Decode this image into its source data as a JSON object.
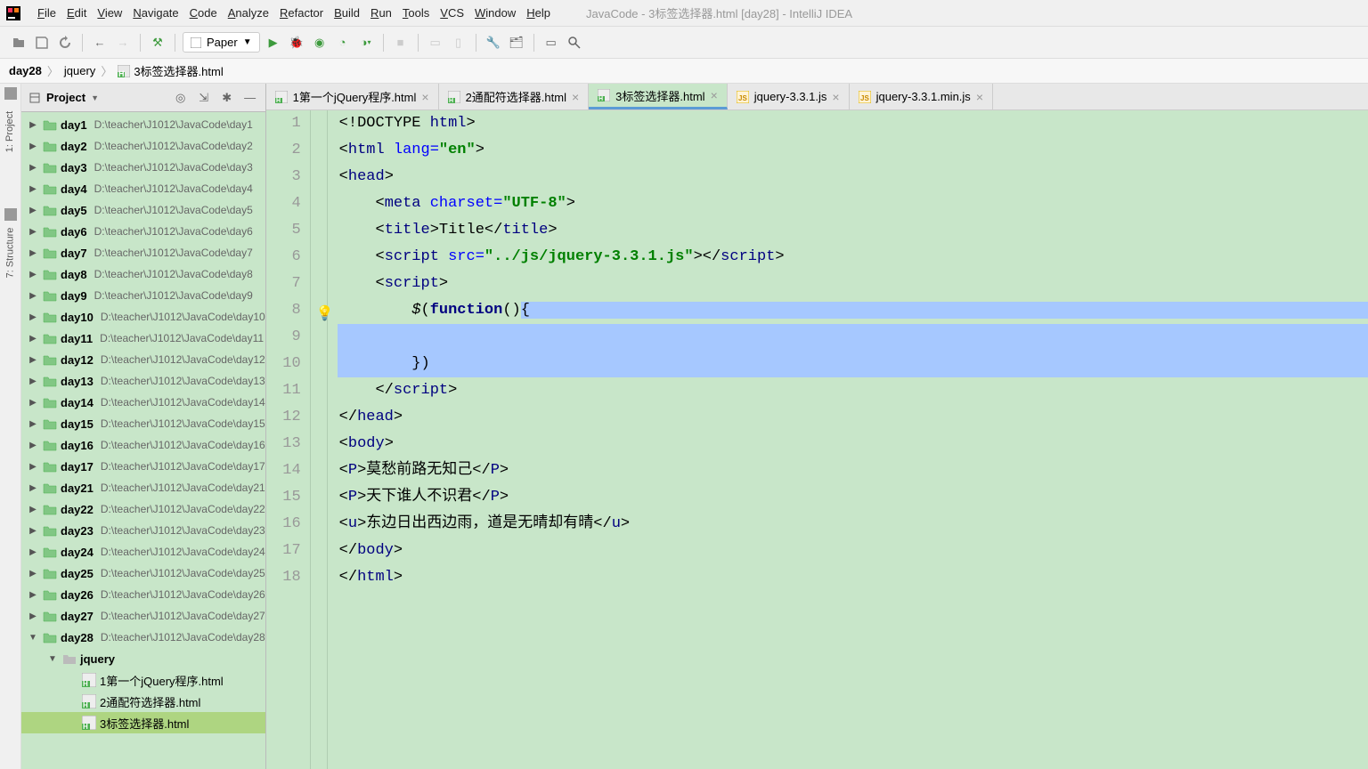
{
  "window_title": "JavaCode - 3标签选择器.html [day28] - IntelliJ IDEA",
  "menu": [
    "File",
    "Edit",
    "View",
    "Navigate",
    "Code",
    "Analyze",
    "Refactor",
    "Build",
    "Run",
    "Tools",
    "VCS",
    "Window",
    "Help"
  ],
  "config_selector": "Paper",
  "breadcrumb": [
    {
      "label": "day28",
      "icon": "folder"
    },
    {
      "label": "jquery",
      "icon": "none"
    },
    {
      "label": "3标签选择器.html",
      "icon": "html"
    }
  ],
  "left_rail": [
    {
      "label": "1: Project"
    },
    {
      "label": "7: Structure"
    }
  ],
  "project_panel_title": "Project",
  "tree": [
    {
      "name": "day1",
      "path": "D:\\teacher\\J1012\\JavaCode\\day1",
      "indent": 0,
      "expanded": false,
      "type": "folder"
    },
    {
      "name": "day2",
      "path": "D:\\teacher\\J1012\\JavaCode\\day2",
      "indent": 0,
      "expanded": false,
      "type": "folder"
    },
    {
      "name": "day3",
      "path": "D:\\teacher\\J1012\\JavaCode\\day3",
      "indent": 0,
      "expanded": false,
      "type": "folder"
    },
    {
      "name": "day4",
      "path": "D:\\teacher\\J1012\\JavaCode\\day4",
      "indent": 0,
      "expanded": false,
      "type": "folder"
    },
    {
      "name": "day5",
      "path": "D:\\teacher\\J1012\\JavaCode\\day5",
      "indent": 0,
      "expanded": false,
      "type": "folder"
    },
    {
      "name": "day6",
      "path": "D:\\teacher\\J1012\\JavaCode\\day6",
      "indent": 0,
      "expanded": false,
      "type": "folder"
    },
    {
      "name": "day7",
      "path": "D:\\teacher\\J1012\\JavaCode\\day7",
      "indent": 0,
      "expanded": false,
      "type": "folder"
    },
    {
      "name": "day8",
      "path": "D:\\teacher\\J1012\\JavaCode\\day8",
      "indent": 0,
      "expanded": false,
      "type": "folder"
    },
    {
      "name": "day9",
      "path": "D:\\teacher\\J1012\\JavaCode\\day9",
      "indent": 0,
      "expanded": false,
      "type": "folder"
    },
    {
      "name": "day10",
      "path": "D:\\teacher\\J1012\\JavaCode\\day10",
      "indent": 0,
      "expanded": false,
      "type": "folder"
    },
    {
      "name": "day11",
      "path": "D:\\teacher\\J1012\\JavaCode\\day11",
      "indent": 0,
      "expanded": false,
      "type": "folder"
    },
    {
      "name": "day12",
      "path": "D:\\teacher\\J1012\\JavaCode\\day12",
      "indent": 0,
      "expanded": false,
      "type": "folder"
    },
    {
      "name": "day13",
      "path": "D:\\teacher\\J1012\\JavaCode\\day13",
      "indent": 0,
      "expanded": false,
      "type": "folder"
    },
    {
      "name": "day14",
      "path": "D:\\teacher\\J1012\\JavaCode\\day14",
      "indent": 0,
      "expanded": false,
      "type": "folder"
    },
    {
      "name": "day15",
      "path": "D:\\teacher\\J1012\\JavaCode\\day15",
      "indent": 0,
      "expanded": false,
      "type": "folder"
    },
    {
      "name": "day16",
      "path": "D:\\teacher\\J1012\\JavaCode\\day16",
      "indent": 0,
      "expanded": false,
      "type": "folder"
    },
    {
      "name": "day17",
      "path": "D:\\teacher\\J1012\\JavaCode\\day17",
      "indent": 0,
      "expanded": false,
      "type": "folder"
    },
    {
      "name": "day21",
      "path": "D:\\teacher\\J1012\\JavaCode\\day21",
      "indent": 0,
      "expanded": false,
      "type": "folder"
    },
    {
      "name": "day22",
      "path": "D:\\teacher\\J1012\\JavaCode\\day22",
      "indent": 0,
      "expanded": false,
      "type": "folder"
    },
    {
      "name": "day23",
      "path": "D:\\teacher\\J1012\\JavaCode\\day23",
      "indent": 0,
      "expanded": false,
      "type": "folder"
    },
    {
      "name": "day24",
      "path": "D:\\teacher\\J1012\\JavaCode\\day24",
      "indent": 0,
      "expanded": false,
      "type": "folder"
    },
    {
      "name": "day25",
      "path": "D:\\teacher\\J1012\\JavaCode\\day25",
      "indent": 0,
      "expanded": false,
      "type": "folder"
    },
    {
      "name": "day26",
      "path": "D:\\teacher\\J1012\\JavaCode\\day26",
      "indent": 0,
      "expanded": false,
      "type": "folder"
    },
    {
      "name": "day27",
      "path": "D:\\teacher\\J1012\\JavaCode\\day27",
      "indent": 0,
      "expanded": false,
      "type": "folder"
    },
    {
      "name": "day28",
      "path": "D:\\teacher\\J1012\\JavaCode\\day28",
      "indent": 0,
      "expanded": true,
      "type": "folder"
    },
    {
      "name": "jquery",
      "path": "",
      "indent": 1,
      "expanded": true,
      "type": "folder-plain"
    },
    {
      "name": "1第一个jQuery程序.html",
      "path": "",
      "indent": 2,
      "type": "html"
    },
    {
      "name": "2通配符选择器.html",
      "path": "",
      "indent": 2,
      "type": "html"
    },
    {
      "name": "3标签选择器.html",
      "path": "",
      "indent": 2,
      "type": "html",
      "selected": true
    }
  ],
  "tabs": [
    {
      "label": "1第一个jQuery程序.html",
      "icon": "html",
      "active": false
    },
    {
      "label": "2通配符选择器.html",
      "icon": "html",
      "active": false
    },
    {
      "label": "3标签选择器.html",
      "icon": "html",
      "active": true
    },
    {
      "label": "jquery-3.3.1.js",
      "icon": "js",
      "active": false
    },
    {
      "label": "jquery-3.3.1.min.js",
      "icon": "js",
      "active": false
    }
  ],
  "code_lines": [
    {
      "n": 1,
      "html": "&lt;!DOCTYPE <span class='tag'>html</span>&gt;"
    },
    {
      "n": 2,
      "html": "&lt;<span class='tag'>html </span><span class='attr'>lang=</span><span class='str'>\"en\"</span>&gt;"
    },
    {
      "n": 3,
      "html": "&lt;<span class='tag'>head</span>&gt;"
    },
    {
      "n": 4,
      "html": "    &lt;<span class='tag'>meta </span><span class='attr'>charset=</span><span class='str'>\"UTF-8\"</span>&gt;"
    },
    {
      "n": 5,
      "html": "    &lt;<span class='tag'>title</span>&gt;Title&lt;/<span class='tag'>title</span>&gt;"
    },
    {
      "n": 6,
      "html": "    &lt;<span class='tag'>script </span><span class='attr'>src=</span><span class='str'>\"../js/jquery-3.3.1.js\"</span>&gt;&lt;/<span class='tag'>script</span>&gt;"
    },
    {
      "n": 7,
      "html": "    &lt;<span class='tag'>script</span>&gt;"
    },
    {
      "n": 8,
      "html": "        <span class='dollar'>$</span>(<span class='kw'>function</span>(){",
      "sel": "after",
      "bulb": true
    },
    {
      "n": 9,
      "html": "",
      "sel": "full"
    },
    {
      "n": 10,
      "html": "        })",
      "sel": "full"
    },
    {
      "n": 11,
      "html": "    &lt;/<span class='tag'>script</span>&gt;"
    },
    {
      "n": 12,
      "html": "&lt;/<span class='tag'>head</span>&gt;"
    },
    {
      "n": 13,
      "html": "&lt;<span class='tag'>body</span>&gt;"
    },
    {
      "n": 14,
      "html": "&lt;<span class='tag'>P</span>&gt;莫愁前路无知己&lt;/<span class='tag'>P</span>&gt;"
    },
    {
      "n": 15,
      "html": "&lt;<span class='tag'>P</span>&gt;天下谁人不识君&lt;/<span class='tag'>P</span>&gt;"
    },
    {
      "n": 16,
      "html": "&lt;<span class='tag'>u</span>&gt;东边日出西边雨，道是无晴却有晴&lt;/<span class='tag'>u</span>&gt;"
    },
    {
      "n": 17,
      "html": "&lt;/<span class='tag'>body</span>&gt;"
    },
    {
      "n": 18,
      "html": "&lt;/<span class='tag'>html</span>&gt;"
    }
  ]
}
